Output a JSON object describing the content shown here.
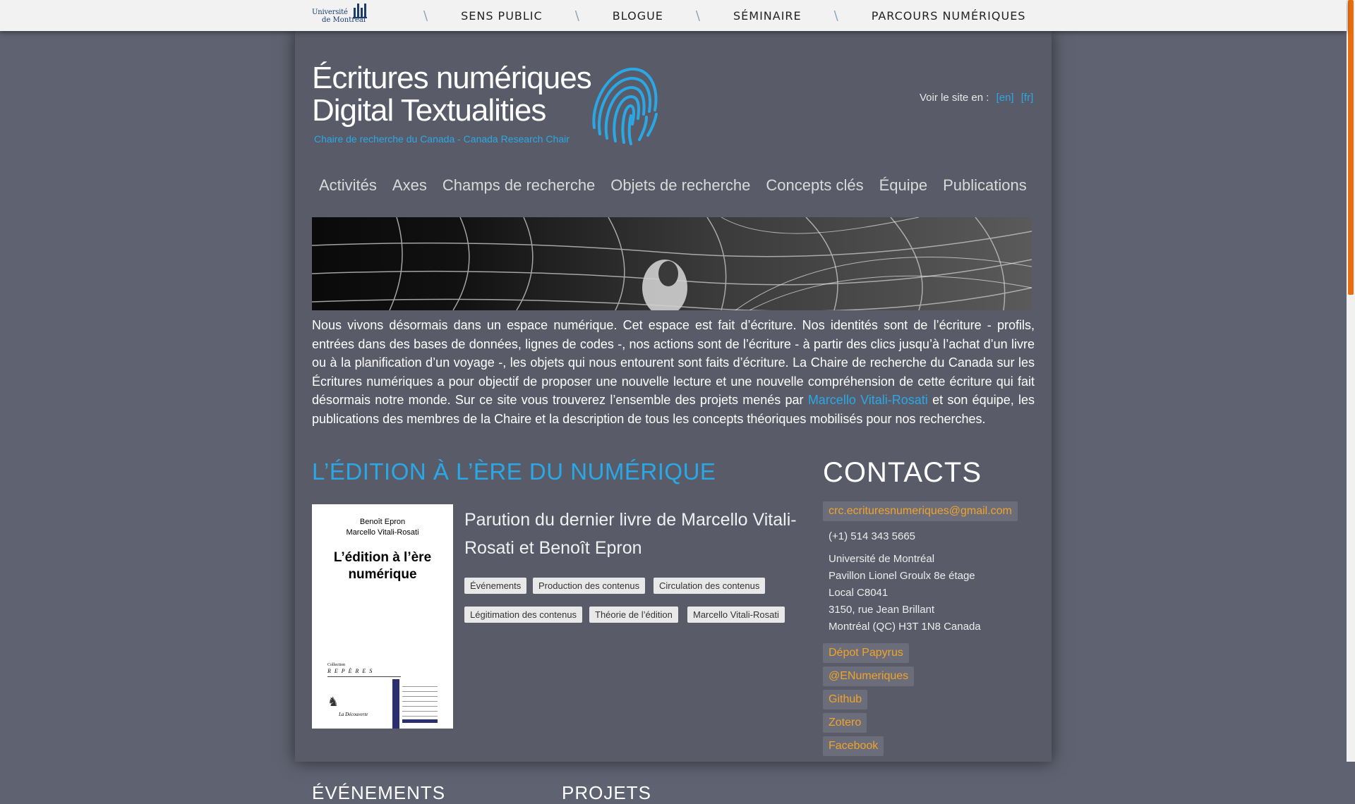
{
  "topbar": {
    "logo": {
      "line1": "Université",
      "line2": "de Montréal"
    },
    "links": [
      "SENS PUBLIC",
      "BLOGUE",
      "SÉMINAIRE",
      "PARCOURS NUMÉRIQUES"
    ],
    "separator": "\\"
  },
  "brand": {
    "title_fr": "Écritures numériques",
    "title_en": "Digital Textualities",
    "subtitle": "Chaire de recherche du Canada - Canada Research Chair"
  },
  "language": {
    "label": "Voir le site en :",
    "en": "[en]",
    "fr": "[fr]"
  },
  "main_nav": [
    "Activités",
    "Axes",
    "Champs de recherche",
    "Objets de recherche",
    "Concepts clés",
    "Équipe",
    "Publications"
  ],
  "intro": {
    "text_before": "Nous vivons désormais dans un espace numérique. Cet espace est fait d’écriture. Nos identités sont de l’écriture - profils, entrées dans des bases de données, lignes de codes -, nos actions sont de l’écriture - à partir des clics jusqu’à l’achat d’un livre ou à la planification d’un voyage -, les objets qui nous entourent sont faits d’écriture. La Chaire de recherche du Canada sur les Écritures numériques a pour objectif de proposer une nouvelle lecture et une nouvelle compréhension de cette écriture qui fait désormais notre monde. Sur ce site vous trouverez l’ensemble des projets menés par ",
    "link": "Marcello Vitali-Rosati",
    "text_after": " et son équipe, les publications des membres de la Chaire et la description de tous les concepts théoriques mobilisés pour nos recherches."
  },
  "featured": {
    "section_title": "L’ÉDITION À L’ÈRE DU NUMÉRIQUE",
    "book": {
      "author1": "Benoît Epron",
      "author2": "Marcello Vitali-Rosati",
      "title_line1": "L’édition à l’ère",
      "title_line2": "numérique",
      "collection": "Collection",
      "series": "REPÈRES",
      "publisher": "La Découverte"
    },
    "article_title": "Parution du dernier livre de Marcello Vitali-Rosati et Benoît Epron",
    "tags": [
      "Événements",
      "Production des contenus",
      "Circulation des contenus",
      "Légitimation des contenus",
      "Théorie de l’édition",
      "Marcello Vitali-Rosati"
    ]
  },
  "bottom_sections": [
    "ÉVÉNEMENTS",
    "PROJETS"
  ],
  "contacts": {
    "title": "CONTACTS",
    "email": "crc.ecrituresnumeriques@gmail.com",
    "phone": "(+1) 514 343 5665",
    "address": [
      "Université de Montréal",
      "Pavillon Lionel Groulx 8e étage",
      "Local C8041",
      "3150, rue Jean Brillant",
      "Montréal (QC) H3T 1N8 Canada"
    ],
    "links": [
      "Dépot Papyrus",
      "@ENumeriques",
      "Github",
      "Zotero",
      "Facebook"
    ]
  },
  "colors": {
    "accent": "#2aa8e6",
    "link_orange": "#f1a328",
    "background": "#5f6270",
    "scroll_thumb": "#e66d10"
  }
}
